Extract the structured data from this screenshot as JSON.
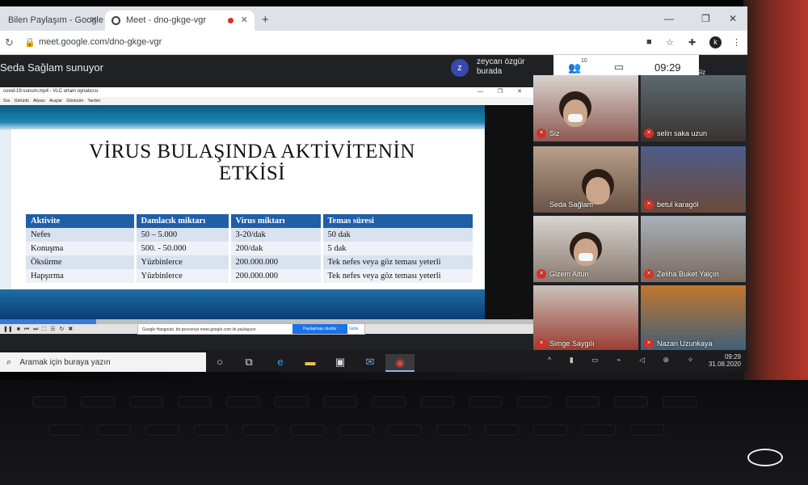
{
  "browser": {
    "tabs": [
      {
        "label": "Bilen Paylaşım - Google"
      },
      {
        "label": "Meet - dno-gkge-vgr"
      }
    ],
    "url": "meet.google.com/dno-gkge-vgr",
    "profile_initial": "k"
  },
  "meet": {
    "presenting_text": "Seda Sağlam sunuyor",
    "presenter_avatar": "z",
    "presenter_name": "zeycan özgür",
    "presenter_sub": "burada",
    "people_count": "10",
    "clock": "09:29",
    "participants": [
      {
        "name": "Siz",
        "muted": true
      },
      {
        "name": "selin saka uzun",
        "muted": true
      },
      {
        "name": "Seda Sağlam",
        "muted": false
      },
      {
        "name": "betul karagöl",
        "muted": true
      },
      {
        "name": "Gizem Altun",
        "muted": true
      },
      {
        "name": "Zeliha Buket Yalçın",
        "muted": true
      },
      {
        "name": "Simge Saygılı",
        "muted": true
      },
      {
        "name": "Nazan Uzunkaya",
        "muted": true
      }
    ],
    "share_notice": "Google Hangouts, bir pencereyi meet.google.com ile paylaşıyor",
    "stop_sharing": "Paylaşmayı durdur",
    "hide": "Gizle",
    "top_right_label": "Siz"
  },
  "vlc": {
    "title": "covid-19-sunum.mp4 - VLC ortam oynatıcısı",
    "menu": [
      "Sss",
      "Görüntü",
      "Altyazı",
      "Araçlar",
      "Görünüm",
      "Yardım"
    ],
    "time": "23:58",
    "progress": 0.18
  },
  "slide": {
    "title_line1": "VİRUS BULAŞINDA AKTİVİTENİN",
    "title_line2": "ETKİSİ",
    "headers": [
      "Aktivite",
      "Damlacık miktarı",
      "Virus miktarı",
      "Temas süresi"
    ],
    "rows": [
      [
        "Nefes",
        "50 – 5.000",
        "3-20/dak",
        "50 dak"
      ],
      [
        "Konuşma",
        "500.  - 50.000",
        "200/dak",
        "5 dak"
      ],
      [
        "Öksürme",
        "Yüzbinlerce",
        "200.000.000",
        "Tek nefes veya göz teması yeterli"
      ],
      [
        "Hapşırma",
        "Yüzbinlerce",
        "200.000.000",
        "Tek nefes veya göz teması yeterli"
      ]
    ]
  },
  "taskbar": {
    "search_placeholder": "Aramak için buraya yazın",
    "time": "09:29",
    "date": "31.08.2020"
  }
}
